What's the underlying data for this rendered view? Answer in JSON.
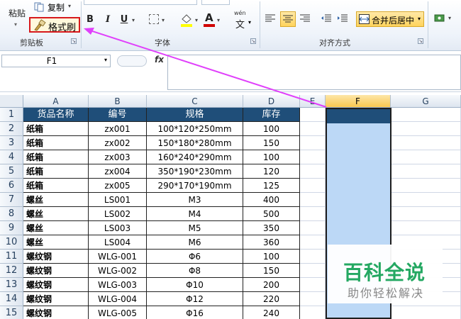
{
  "ribbon": {
    "clipboard": {
      "paste_label": "粘贴",
      "copy_label": "复制",
      "format_painter_label": "格式刷",
      "group_label": "剪贴板"
    },
    "font": {
      "bold": "B",
      "italic": "I",
      "underline": "U",
      "font_color_glyph": "A",
      "wen_glyph": "wén",
      "wen_char": "文",
      "group_label": "字体"
    },
    "alignment": {
      "merge_center_label": "合并后居中",
      "group_label": "对齐方式"
    }
  },
  "formula_bar": {
    "name_box_value": "F1",
    "fx_label": "fx",
    "formula_value": ""
  },
  "grid": {
    "columns": [
      "A",
      "B",
      "C",
      "D",
      "E",
      "F",
      "G"
    ],
    "row_numbers": [
      "1",
      "2",
      "3",
      "4",
      "5",
      "6",
      "7",
      "8",
      "9",
      "10",
      "11",
      "12",
      "13",
      "14",
      "15"
    ],
    "table_headers": [
      "货品名称",
      "编号",
      "规格",
      "库存"
    ],
    "rows": [
      [
        "纸箱",
        "zx001",
        "100*120*250mm",
        "100"
      ],
      [
        "纸箱",
        "zx002",
        "150*180*280mm",
        "150"
      ],
      [
        "纸箱",
        "zx003",
        "160*240*290mm",
        "100"
      ],
      [
        "纸箱",
        "zx004",
        "350*190*230mm",
        "120"
      ],
      [
        "纸箱",
        "zx005",
        "290*170*190mm",
        "125"
      ],
      [
        "螺丝",
        "LS001",
        "M3",
        "400"
      ],
      [
        "螺丝",
        "LS002",
        "M4",
        "500"
      ],
      [
        "螺丝",
        "LS003",
        "M5",
        "350"
      ],
      [
        "螺丝",
        "LS004",
        "M6",
        "360"
      ],
      [
        "螺纹钢",
        "WLG-001",
        "Φ6",
        "100"
      ],
      [
        "螺纹钢",
        "WLG-002",
        "Φ8",
        "150"
      ],
      [
        "螺纹钢",
        "WLG-003",
        "Φ10",
        "200"
      ],
      [
        "螺纹钢",
        "WLG-004",
        "Φ12",
        "220"
      ],
      [
        "螺纹钢",
        "WLG-005",
        "Φ16",
        "240"
      ]
    ],
    "selected_column": "F"
  },
  "watermark": {
    "main": "百科全说",
    "sub": "助你轻松解决"
  },
  "colors": {
    "header_fill": "#1f4e79",
    "selection_fill": "#bcd8f6",
    "annotation_arrow": "#e040fb",
    "highlight_border": "#d7191c",
    "watermark_green": "#24a862"
  }
}
